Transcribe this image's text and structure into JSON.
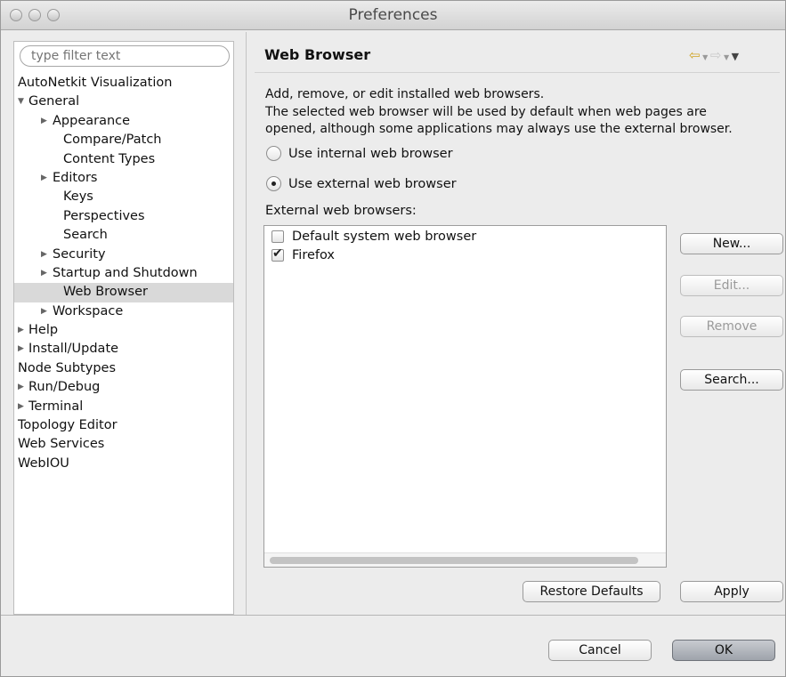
{
  "window": {
    "title": "Preferences"
  },
  "filter": {
    "placeholder": "type filter text"
  },
  "tree": [
    {
      "label": "AutoNetkit Visualization",
      "level": 0,
      "toggle": "",
      "selected": false
    },
    {
      "label": "General",
      "level": 0,
      "toggle": "expanded",
      "selected": false
    },
    {
      "label": "Appearance",
      "level": 1,
      "toggle": "collapsed",
      "selected": false
    },
    {
      "label": "Compare/Patch",
      "level": 1,
      "toggle": "",
      "selected": false
    },
    {
      "label": "Content Types",
      "level": 1,
      "toggle": "",
      "selected": false
    },
    {
      "label": "Editors",
      "level": 1,
      "toggle": "collapsed",
      "selected": false
    },
    {
      "label": "Keys",
      "level": 1,
      "toggle": "",
      "selected": false
    },
    {
      "label": "Perspectives",
      "level": 1,
      "toggle": "",
      "selected": false
    },
    {
      "label": "Search",
      "level": 1,
      "toggle": "",
      "selected": false
    },
    {
      "label": "Security",
      "level": 1,
      "toggle": "collapsed",
      "selected": false
    },
    {
      "label": "Startup and Shutdown",
      "level": 1,
      "toggle": "collapsed",
      "selected": false
    },
    {
      "label": "Web Browser",
      "level": 1,
      "toggle": "",
      "selected": true
    },
    {
      "label": "Workspace",
      "level": 1,
      "toggle": "collapsed",
      "selected": false
    },
    {
      "label": "Help",
      "level": 0,
      "toggle": "collapsed",
      "selected": false
    },
    {
      "label": "Install/Update",
      "level": 0,
      "toggle": "collapsed",
      "selected": false
    },
    {
      "label": "Node Subtypes",
      "level": 0,
      "toggle": "",
      "selected": false
    },
    {
      "label": "Run/Debug",
      "level": 0,
      "toggle": "collapsed",
      "selected": false
    },
    {
      "label": "Terminal",
      "level": 0,
      "toggle": "collapsed",
      "selected": false
    },
    {
      "label": "Topology Editor",
      "level": 0,
      "toggle": "",
      "selected": false
    },
    {
      "label": "Web Services",
      "level": 0,
      "toggle": "",
      "selected": false
    },
    {
      "label": "WebIOU",
      "level": 0,
      "toggle": "",
      "selected": false
    }
  ],
  "panel": {
    "title": "Web Browser",
    "desc_line1": "Add, remove, or edit installed web browsers.",
    "desc_line2": "The selected web browser will be used by default when web pages are",
    "desc_line3": "opened, although some applications may always use the external browser.",
    "radio_internal": "Use internal web browser",
    "radio_external": "Use external web browser",
    "selected_radio": "external",
    "external_label": "External web browsers:",
    "browsers": [
      {
        "name": "Default system web browser",
        "checked": false
      },
      {
        "name": "Firefox",
        "checked": true
      }
    ]
  },
  "buttons": {
    "new": "New...",
    "edit": "Edit...",
    "remove": "Remove",
    "search": "Search...",
    "restore": "Restore Defaults",
    "apply": "Apply",
    "cancel": "Cancel",
    "ok": "OK"
  },
  "nav": {
    "back_icon": "back-arrow-icon",
    "forward_icon": "forward-arrow-icon",
    "menu_icon": "view-menu-icon",
    "accent": "#cfa323"
  }
}
